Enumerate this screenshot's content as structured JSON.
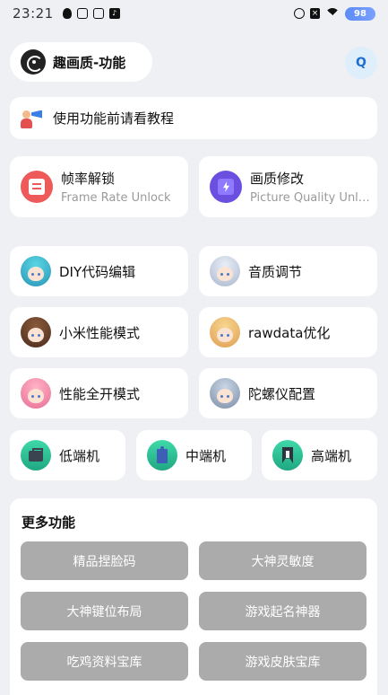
{
  "status_bar": {
    "time": "23:21",
    "battery": "98",
    "left_icons": [
      "qq-icon",
      "link-icon",
      "play-icon",
      "tiktok-icon"
    ],
    "right_icons": [
      "alarm-icon",
      "no-sim-icon",
      "wifi-icon",
      "battery-icon"
    ]
  },
  "header": {
    "title": "趣画质-功能",
    "action_label": "Q"
  },
  "tutorial": {
    "text": "使用功能前请看教程",
    "icon": "megaphone-icon"
  },
  "main_features": [
    {
      "title": "帧率解锁",
      "subtitle": "Frame Rate Unlock",
      "icon": "frame-rate-icon",
      "color": "#ee5a5a"
    },
    {
      "title": "画质修改",
      "subtitle": "Picture Quality Unl…",
      "icon": "picture-quality-icon",
      "color": "#6a4fe0"
    }
  ],
  "features": [
    {
      "label": "DIY代码编辑",
      "avatar": "avatar-teal-hair"
    },
    {
      "label": "音质调节",
      "avatar": "avatar-silver-hair"
    },
    {
      "label": "小米性能模式",
      "avatar": "avatar-brown-hair"
    },
    {
      "label": "rawdata优化",
      "avatar": "avatar-blonde-hair"
    },
    {
      "label": "性能全开模式",
      "avatar": "avatar-pink-hair"
    },
    {
      "label": "陀螺仪配置",
      "avatar": "avatar-gray-hair"
    }
  ],
  "device_tiers": [
    {
      "label": "低端机",
      "icon": "briefcase-icon"
    },
    {
      "label": "中端机",
      "icon": "building-icon"
    },
    {
      "label": "高端机",
      "icon": "tower-icon"
    }
  ],
  "more": {
    "title": "更多功能",
    "buttons": [
      "精品捏脸码",
      "大神灵敏度",
      "大神键位布局",
      "游戏起名神器",
      "吃鸡资料宝库",
      "游戏皮肤宝库"
    ]
  },
  "colors": {
    "background": "#eef0f3",
    "card": "#ffffff",
    "gray_button": "#ababab",
    "accent_blue": "#1f6fd1",
    "tier_green": "#2bc596"
  }
}
